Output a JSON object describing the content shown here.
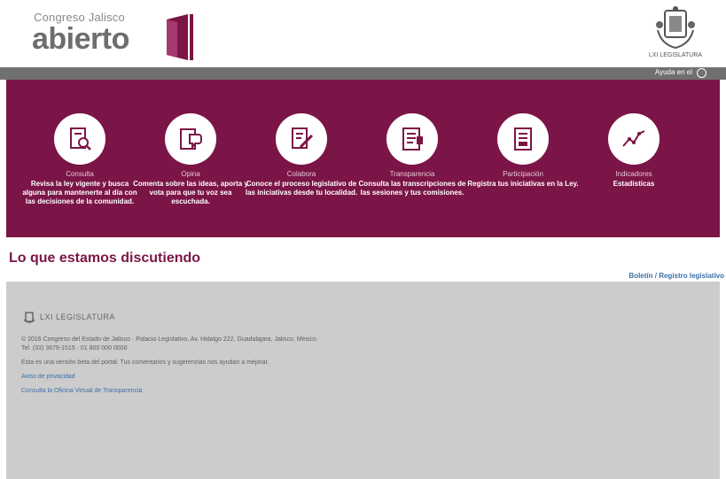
{
  "header": {
    "logo_line1": "Congreso Jalisco",
    "logo_line2": "abierto",
    "seal_caption": "LXI LEGISLATURA"
  },
  "topbar": {
    "language": "Ayuda en el"
  },
  "features": [
    {
      "icon": "search-document-icon",
      "title": "Consulta",
      "desc": "Revisa la ley vigente y busca alguna para mantenerte al día con las decisiones de la comunidad."
    },
    {
      "icon": "speech-bubble-icon",
      "title": "Opina",
      "desc": "Comenta sobre las ideas, aporta y vota para que tu voz sea escuchada."
    },
    {
      "icon": "edit-document-icon",
      "title": "Colabora",
      "desc": "Conoce el proceso legislativo de las iniciativas desde tu localidad."
    },
    {
      "icon": "document-list-icon",
      "title": "Transparencia",
      "desc": "Consulta las transcripciones de las sesiones y tus comisiones."
    },
    {
      "icon": "checklist-document-icon",
      "title": "Participación",
      "desc": "Registra tus iniciativas en la Ley."
    },
    {
      "icon": "statistics-chart-icon",
      "title": "Indicadores",
      "desc": "Estadísticas"
    }
  ],
  "discussion": {
    "heading": "Lo que estamos discutiendo",
    "more_link": "Boletín / Registro legislativo"
  },
  "footer": {
    "logo_text": "LXI LEGISLATURA",
    "address": "© 2016 Congreso del Estado de Jalisco · Palacio Legislativo, Av. Hidalgo 222, Guadalajara, Jalisco, México",
    "phone": "Tel. (33) 3679-1515 · 01 800 000 0000",
    "note": "Esta es una versión beta del portal. Tus comentarios y sugerencias nos ayudan a mejorar.",
    "link1": "Aviso de privacidad",
    "link2": "Consulta la Oficina Virtual de Transparencia"
  },
  "colors": {
    "maroon": "#7b1547",
    "grey_bar": "#707070",
    "footer_bg": "#cccccc",
    "link": "#3c6fa5"
  }
}
